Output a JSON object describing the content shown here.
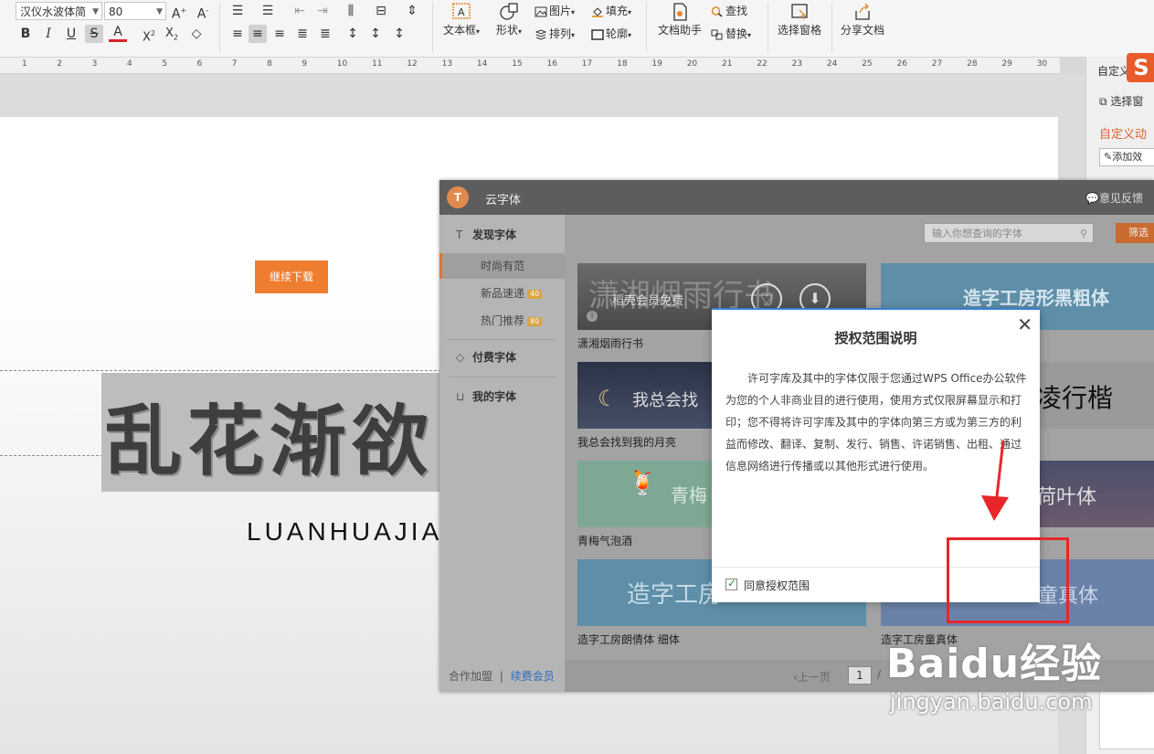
{
  "ribbon": {
    "font_name": "汉仪水波体简",
    "font_size": "80",
    "text_box_label": "文本框",
    "shape_label": "形状",
    "picture_label": "图片",
    "arrange_label": "排列",
    "fill_label": "填充",
    "outline_label": "轮廓",
    "doc_helper_label": "文档助手",
    "find_label": "查找",
    "replace_label": "替换",
    "selection_pane_label": "选择窗格",
    "share_doc_label": "分享文档"
  },
  "ruler": {
    "ticks": [
      "1",
      "2",
      "3",
      "4",
      "5",
      "6",
      "7",
      "8",
      "9",
      "10",
      "11",
      "12",
      "13",
      "14",
      "15",
      "16",
      "17",
      "18",
      "19",
      "20",
      "21",
      "22",
      "23",
      "24",
      "25",
      "26",
      "27",
      "28",
      "29",
      "30",
      "31"
    ]
  },
  "slide": {
    "title": "乱花渐欲",
    "subtitle": "LUANHUAJIA"
  },
  "side_panel": {
    "custom_label": "自定义",
    "select_window_label": "选择窗",
    "custom_anim_label": "自定义动",
    "add_effect_label": "添加效"
  },
  "cloud_font": {
    "title": "云字体",
    "feedback": "意见反馈",
    "search_placeholder": "输入你想查询的字体",
    "filter_label": "筛选",
    "nav": {
      "discover": "发现字体",
      "trending": "时尚有范",
      "new_arrivals": "新品速递",
      "new_badge": "40",
      "hot": "热门推荐",
      "hot_badge": "80",
      "paid": "付费字体",
      "mine": "我的字体"
    },
    "footer_join": "合作加盟",
    "footer_sep": "|",
    "footer_vip": "续费会员",
    "cards": [
      {
        "name": "潇湘烟雨行书",
        "preview": "潇湘烟雨行书",
        "overlay": "稻壳会员免费"
      },
      {
        "name": "",
        "preview": "造字工房形黑粗体"
      },
      {
        "name": "我总会找到我的月亮",
        "preview": "我总会找"
      },
      {
        "name": "",
        "preview": "凌行楷"
      },
      {
        "name": "青梅气泡酒",
        "preview": "青梅"
      },
      {
        "name": "",
        "preview": "荷叶体"
      },
      {
        "name": "造字工房朗倩体 细体",
        "preview": "造字工房"
      },
      {
        "name": "造字工房童真体",
        "preview": "童真体"
      }
    ],
    "pager": {
      "prev": "上一页",
      "current": "1",
      "slash": "/"
    }
  },
  "auth_modal": {
    "title": "授权范围说明",
    "close": "✕",
    "body": "许可字库及其中的字体仅限于您通过WPS Office办公软件为您的个人非商业目的进行使用，使用方式仅限屏幕显示和打印；您不得将许可字库及其中的字体向第三方或为第三方的利益而修改、翻译、复制、发行、销售、许诺销售、出租、通过信息网络进行传播或以其他形式进行使用。",
    "agree_label": "同意授权范围",
    "continue_label": "继续下载"
  },
  "watermark": {
    "brand": "Baidu经验",
    "url": "jingyan.baidu.com"
  },
  "colors": {
    "accent_orange": "#ee7d30",
    "annotation_red": "#e8262a",
    "modal_top_line": "#3b7fd3"
  }
}
